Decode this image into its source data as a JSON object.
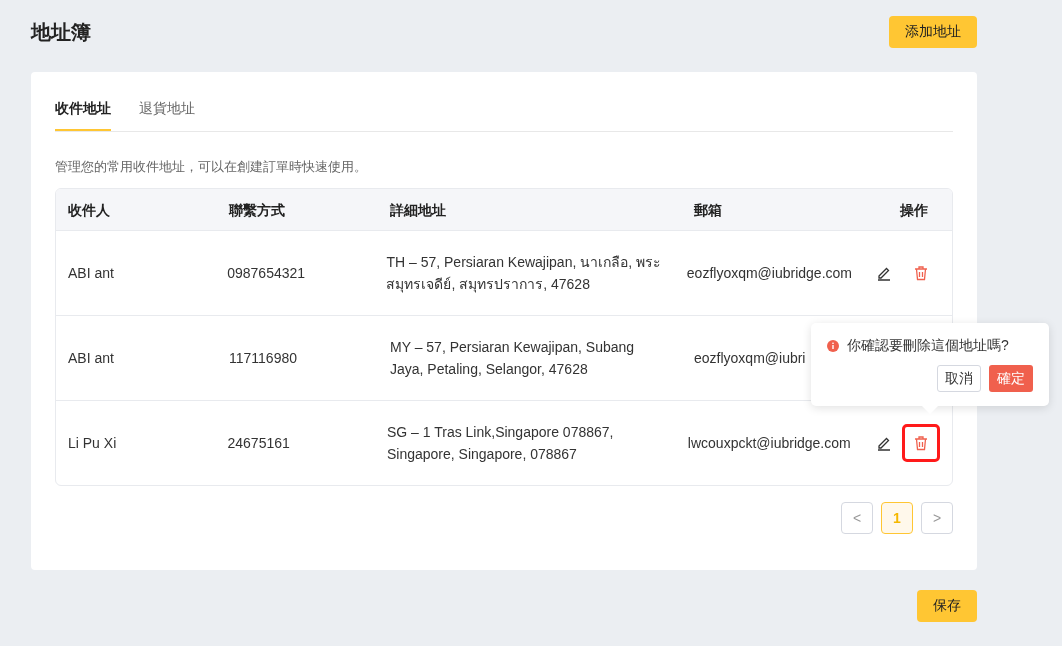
{
  "page": {
    "title": "地址簿",
    "add_button": "添加地址",
    "save_button": "保存"
  },
  "tabs": [
    {
      "label": "收件地址",
      "selected": true
    },
    {
      "label": "退貨地址",
      "selected": false
    }
  ],
  "description": "管理您的常用收件地址，可以在創建訂單時快速使用。",
  "table": {
    "columns": [
      "收件人",
      "聯繫方式",
      "詳細地址",
      "郵箱",
      "操作"
    ],
    "rows": [
      {
        "name": "ABI ant",
        "contact": "0987654321",
        "address": "TH – 57, Persiaran Kewajipan, นาเกลือ, พระสมุทรเจดีย์, สมุทรปราการ, 47628",
        "email": "eozflyoxqm@iubridge.com",
        "actions_covered": false,
        "delete_highlighted": false
      },
      {
        "name": "ABI ant",
        "contact": "117116980",
        "address": "MY – 57, Persiaran Kewajipan, Subang Jaya, Petaling, Selangor, 47628",
        "email": "eozflyoxqm@iubri",
        "actions_covered": true
      },
      {
        "name": "Li Pu Xi",
        "contact": "24675161",
        "address": "SG – 1 Tras Link,Singapore 078867, Singapore, Singapore, 078867",
        "email": "lwcouxpckt@iubridge.com",
        "actions_covered": false,
        "delete_highlighted": true
      }
    ]
  },
  "pagination": {
    "prev": "<",
    "pages": [
      {
        "label": "1",
        "selected": true
      }
    ],
    "next": ">"
  },
  "popconfirm": {
    "message": "你確認要刪除這個地址嗎?",
    "cancel": "取消",
    "confirm": "確定"
  }
}
